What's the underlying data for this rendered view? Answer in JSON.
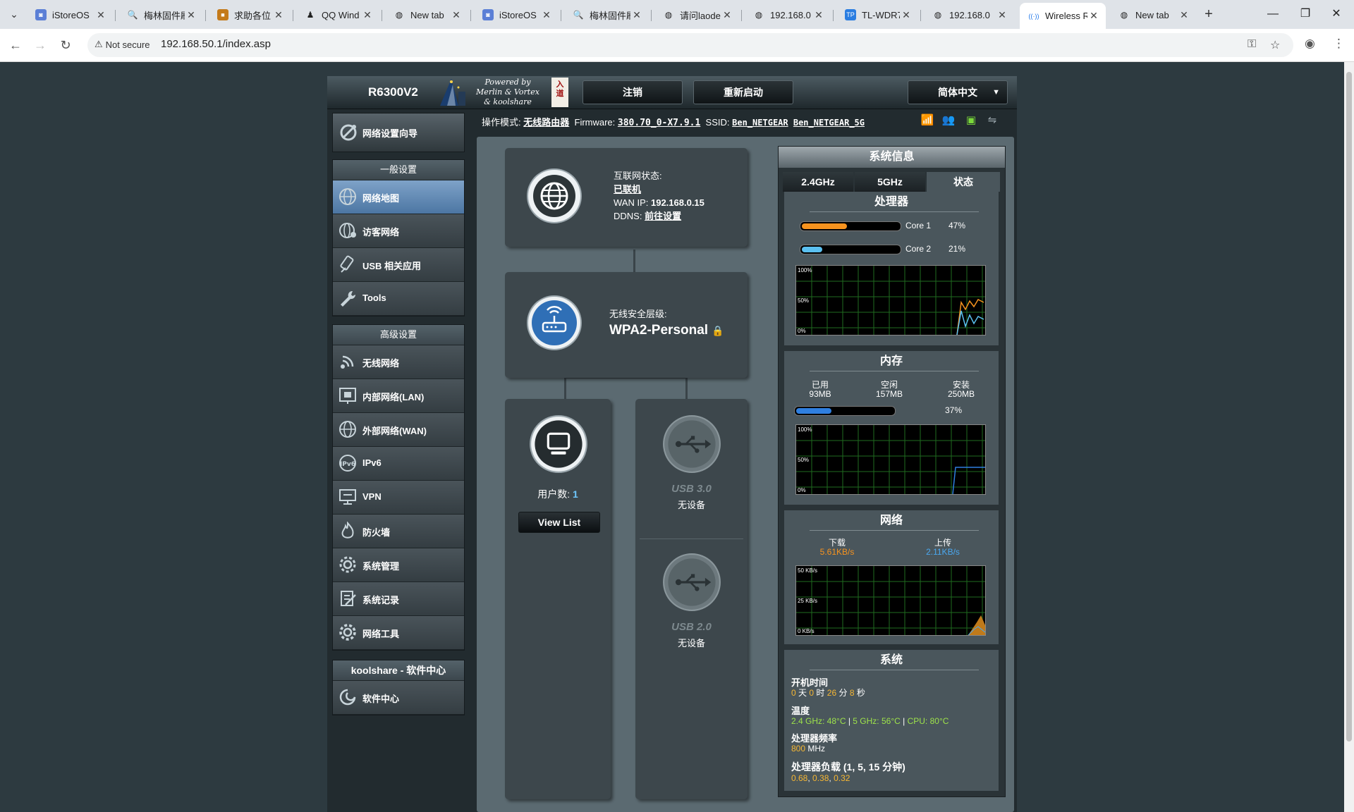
{
  "browser": {
    "tabs": [
      {
        "title": "iStoreOS",
        "icon": "istoreos-icon"
      },
      {
        "title": "梅林固件刷",
        "icon": "search-icon"
      },
      {
        "title": "求助各位",
        "icon": "forum-icon"
      },
      {
        "title": "QQ Wind",
        "icon": "qq-icon"
      },
      {
        "title": "New tab",
        "icon": "chrome-icon"
      },
      {
        "title": "iStoreOS",
        "icon": "istoreos-icon"
      },
      {
        "title": "梅林固件刷",
        "icon": "search-icon"
      },
      {
        "title": "请问laode",
        "icon": "globe-icon"
      },
      {
        "title": "192.168.0",
        "icon": "globe-icon"
      },
      {
        "title": "TL-WDR7",
        "icon": "tplink-icon"
      },
      {
        "title": "192.168.0",
        "icon": "globe-icon"
      },
      {
        "title": "Wireless R",
        "icon": "wireless-icon"
      },
      {
        "title": "New tab",
        "icon": "chrome-icon"
      }
    ],
    "not_secure": "Not secure",
    "url": "192.168.50.1/index.asp"
  },
  "router": {
    "model": "R6300V2",
    "powered_lines": [
      "Powered by",
      "Merlin & Vortex",
      "& koolshare"
    ],
    "stamp": "入道",
    "logout": "注销",
    "reboot": "重新启动",
    "language": "简体中文",
    "status_line": {
      "mode_label": "操作模式:",
      "mode_value": "无线路由器",
      "fw_label": "Firmware:",
      "fw_value": "380.70_0-X7.9.1",
      "ssid_label": "SSID:",
      "ssid_1": "Ben_NETGEAR",
      "ssid_2": "Ben_NETGEAR_5G"
    }
  },
  "menu": {
    "wizard": "网络设置向导",
    "general_title": "一般设置",
    "general": [
      {
        "label": "网络地图",
        "icon": "network-map-icon"
      },
      {
        "label": "访客网络",
        "icon": "guest-network-icon"
      },
      {
        "label": "USB 相关应用",
        "icon": "usb-app-icon"
      },
      {
        "label": "Tools",
        "icon": "wrench-icon"
      }
    ],
    "advanced_title": "高级设置",
    "advanced": [
      {
        "label": "无线网络",
        "icon": "wireless-icon"
      },
      {
        "label": "内部网络(LAN)",
        "icon": "lan-icon"
      },
      {
        "label": "外部网络(WAN)",
        "icon": "wan-globe-icon"
      },
      {
        "label": "IPv6",
        "icon": "ipv6-icon"
      },
      {
        "label": "VPN",
        "icon": "vpn-icon"
      },
      {
        "label": "防火墙",
        "icon": "firewall-icon"
      },
      {
        "label": "系统管理",
        "icon": "admin-gear-icon"
      },
      {
        "label": "系统记录",
        "icon": "system-log-icon"
      },
      {
        "label": "网络工具",
        "icon": "network-tools-icon"
      }
    ],
    "ks_title": "koolshare - 软件中心",
    "ks_item": "软件中心"
  },
  "map": {
    "internet_label": "互联网状态:",
    "internet_status": "已联机",
    "wan_ip_label": "WAN IP:",
    "wan_ip": "192.168.0.15",
    "ddns_label": "DDNS:",
    "ddns_link": "前往设置",
    "sec_label": "无线安全层级:",
    "sec_value": "WPA2-Personal",
    "clients_label": "用户数:",
    "clients_count": "1",
    "view_list": "View List",
    "usb3_label": "USB 3.0",
    "usb3_status": "无设备",
    "usb2_label": "USB 2.0",
    "usb2_status": "无设备"
  },
  "sysinfo": {
    "title": "系统信息",
    "tabs": [
      "2.4GHz",
      "5GHz",
      "状态"
    ],
    "cpu_title": "处理器",
    "cores": [
      {
        "name": "Core 1",
        "pct": "47%",
        "value": 0.47,
        "color": "#f7931e"
      },
      {
        "name": "Core 2",
        "pct": "21%",
        "value": 0.21,
        "color": "#5bc0f0"
      }
    ],
    "graph_ticks": [
      "100%",
      "50%",
      "0%"
    ],
    "mem_title": "内存",
    "mem": [
      {
        "label": "已用",
        "value": "93MB"
      },
      {
        "label": "空闲",
        "value": "157MB"
      },
      {
        "label": "安装",
        "value": "250MB"
      }
    ],
    "mem_pct": "37%",
    "mem_value": 0.37,
    "net_title": "网络",
    "download_label": "下载",
    "download": "5.61KB/s",
    "upload_label": "上传",
    "upload": "2.11KB/s",
    "net_ticks": [
      "50 KB/s",
      "25 KB/s",
      "0 KB/s"
    ],
    "sys_title": "系统",
    "uptime_label": "开机时间",
    "uptime": {
      "d": "0",
      "d_u": "天",
      "h": "0",
      "h_u": "时",
      "m": "26",
      "m_u": "分",
      "s": "8",
      "s_u": "秒"
    },
    "temp_label": "温度",
    "temp_24": "2.4 GHz: 48°C",
    "temp_5": "5 GHz: 56°C",
    "temp_cpu": "CPU: 80°C",
    "freq_label": "处理器频率",
    "freq": "800",
    "freq_unit": "MHz",
    "load_label": "处理器负载 (1, 5, 15 分钟)",
    "load": [
      "0.68",
      "0.38",
      "0.32"
    ]
  }
}
